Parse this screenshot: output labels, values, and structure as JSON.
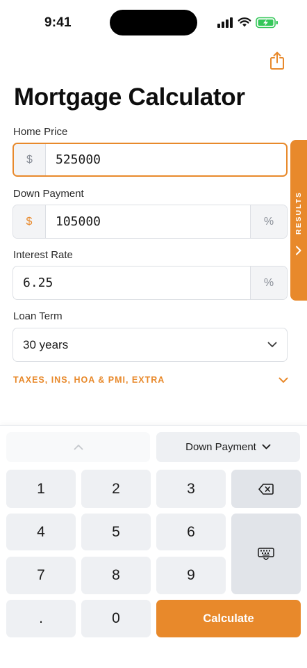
{
  "status_bar": {
    "time": "9:41"
  },
  "header": {
    "title": "Mortgage Calculator"
  },
  "fields": {
    "home_price": {
      "label": "Home Price",
      "prefix": "$",
      "value": "525000"
    },
    "down_payment": {
      "label": "Down Payment",
      "prefix": "$",
      "value": "105000",
      "suffix": "%"
    },
    "interest_rate": {
      "label": "Interest Rate",
      "value": "6.25",
      "suffix": "%"
    },
    "loan_term": {
      "label": "Loan Term",
      "value": "30 years"
    }
  },
  "extras": {
    "label": "TAXES, INS, HOA & PMI, EXTRA"
  },
  "results_tab": {
    "label": "RESULTS"
  },
  "keypad": {
    "field_selector": "Down Payment",
    "keys": [
      "1",
      "2",
      "3",
      "4",
      "5",
      "6",
      "7",
      "8",
      "9",
      ".",
      "0"
    ],
    "calculate_label": "Calculate"
  },
  "colors": {
    "accent": "#e8892b",
    "key_bg": "#eef0f3",
    "border": "#dcdfe4"
  },
  "icons": [
    "share-icon",
    "chevron-down-icon",
    "chevron-right-icon",
    "chevron-up-icon",
    "backspace-icon",
    "keyboard-icon"
  ]
}
